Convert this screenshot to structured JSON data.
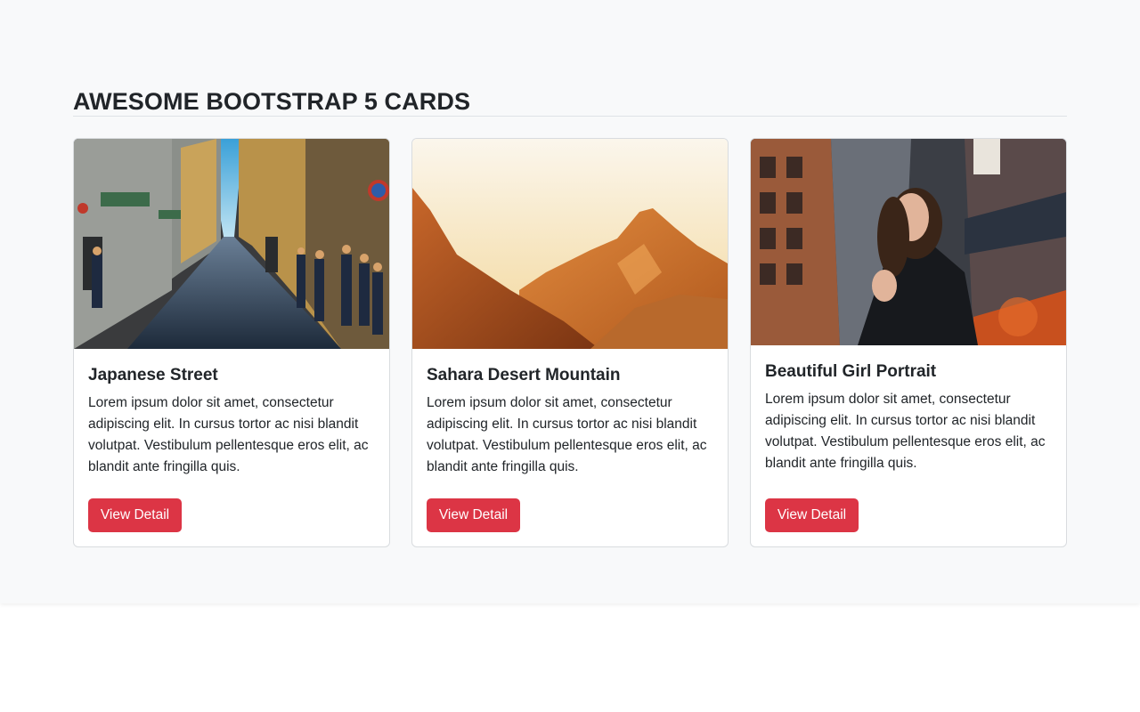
{
  "page": {
    "heading": "AWESOME BOOTSTRAP 5 CARDS"
  },
  "cards": [
    {
      "image_alt": "Japanese Street",
      "title": "Japanese Street",
      "text": "Lorem ipsum dolor sit amet, consectetur adipiscing elit. In cursus tortor ac nisi blandit volutpat. Vestibulum pellentesque eros elit, ac blandit ante fringilla quis.",
      "button_label": "View Detail"
    },
    {
      "image_alt": "Sahara Desert Mountain",
      "title": "Sahara Desert Mountain",
      "text": "Lorem ipsum dolor sit amet, consectetur adipiscing elit. In cursus tortor ac nisi blandit volutpat. Vestibulum pellentesque eros elit, ac blandit ante fringilla quis.",
      "button_label": "View Detail"
    },
    {
      "image_alt": "Beautiful Girl Portrait",
      "title": "Beautiful Girl Portrait",
      "text": "Lorem ipsum dolor sit amet, consectetur adipiscing elit. In cursus tortor ac nisi blandit volutpat. Vestibulum pellentesque eros elit, ac blandit ante fringilla quis.",
      "button_label": "View Detail"
    }
  ],
  "colors": {
    "section_bg": "#f8f9fa",
    "button_bg": "#dc3545",
    "text": "#212529"
  }
}
